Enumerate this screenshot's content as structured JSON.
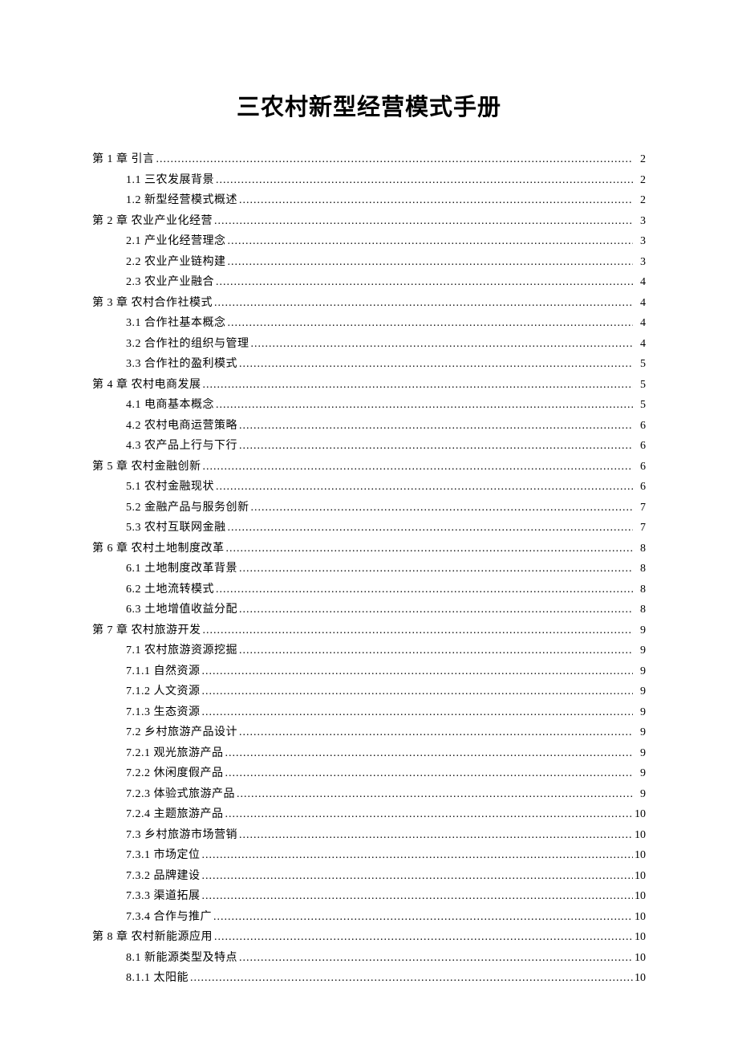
{
  "title": "三农村新型经营模式手册",
  "toc": [
    {
      "level": 0,
      "label": "第 1 章  引言 ",
      "page": "2"
    },
    {
      "level": 1,
      "label": "1.1 三农发展背景",
      "page": "2"
    },
    {
      "level": 1,
      "label": "1.2 新型经营模式概述",
      "page": "2"
    },
    {
      "level": 0,
      "label": "第 2 章  农业产业化经营",
      "page": "3"
    },
    {
      "level": 1,
      "label": "2.1 产业化经营理念",
      "page": "3"
    },
    {
      "level": 1,
      "label": "2.2 农业产业链构建",
      "page": "3"
    },
    {
      "level": 1,
      "label": "2.3 农业产业融合",
      "page": "4"
    },
    {
      "level": 0,
      "label": "第 3 章  农村合作社模式",
      "page": "4"
    },
    {
      "level": 1,
      "label": "3.1 合作社基本概念",
      "page": "4"
    },
    {
      "level": 1,
      "label": "3.2 合作社的组织与管理",
      "page": "4"
    },
    {
      "level": 1,
      "label": "3.3 合作社的盈利模式",
      "page": "5"
    },
    {
      "level": 0,
      "label": "第 4 章  农村电商发展",
      "page": "5"
    },
    {
      "level": 1,
      "label": "4.1 电商基本概念",
      "page": "5"
    },
    {
      "level": 1,
      "label": "4.2 农村电商运营策略",
      "page": "6"
    },
    {
      "level": 1,
      "label": "4.3 农产品上行与下行",
      "page": "6"
    },
    {
      "level": 0,
      "label": "第 5 章  农村金融创新",
      "page": "6"
    },
    {
      "level": 1,
      "label": "5.1 农村金融现状",
      "page": "6"
    },
    {
      "level": 1,
      "label": "5.2 金融产品与服务创新",
      "page": "7"
    },
    {
      "level": 1,
      "label": "5.3 农村互联网金融",
      "page": "7"
    },
    {
      "level": 0,
      "label": "第 6 章  农村土地制度改革",
      "page": "8"
    },
    {
      "level": 1,
      "label": "6.1 土地制度改革背景",
      "page": "8"
    },
    {
      "level": 1,
      "label": "6.2 土地流转模式",
      "page": "8"
    },
    {
      "level": 1,
      "label": "6.3 土地增值收益分配",
      "page": "8"
    },
    {
      "level": 0,
      "label": "第 7 章  农村旅游开发",
      "page": "9"
    },
    {
      "level": 1,
      "label": "7.1 农村旅游资源挖掘",
      "page": "9"
    },
    {
      "level": 1,
      "label": "7.1.1 自然资源",
      "page": "9"
    },
    {
      "level": 1,
      "label": "7.1.2 人文资源",
      "page": "9"
    },
    {
      "level": 1,
      "label": "7.1.3 生态资源",
      "page": "9"
    },
    {
      "level": 1,
      "label": "7.2 乡村旅游产品设计",
      "page": "9"
    },
    {
      "level": 1,
      "label": "7.2.1 观光旅游产品",
      "page": "9"
    },
    {
      "level": 1,
      "label": "7.2.2 休闲度假产品",
      "page": "9"
    },
    {
      "level": 1,
      "label": "7.2.3 体验式旅游产品",
      "page": "9"
    },
    {
      "level": 1,
      "label": "7.2.4 主题旅游产品",
      "page": "10"
    },
    {
      "level": 1,
      "label": "7.3 乡村旅游市场营销",
      "page": "10"
    },
    {
      "level": 1,
      "label": "7.3.1 市场定位 ",
      "page": "10"
    },
    {
      "level": 1,
      "label": "7.3.2 品牌建设 ",
      "page": "10"
    },
    {
      "level": 1,
      "label": "7.3.3 渠道拓展 ",
      "page": "10"
    },
    {
      "level": 1,
      "label": "7.3.4 合作与推广",
      "page": "10"
    },
    {
      "level": 0,
      "label": "第 8 章  农村新能源应用",
      "page": "10"
    },
    {
      "level": 1,
      "label": "8.1 新能源类型及特点",
      "page": "10"
    },
    {
      "level": 1,
      "label": "8.1.1 太阳能 ",
      "page": "10"
    }
  ]
}
